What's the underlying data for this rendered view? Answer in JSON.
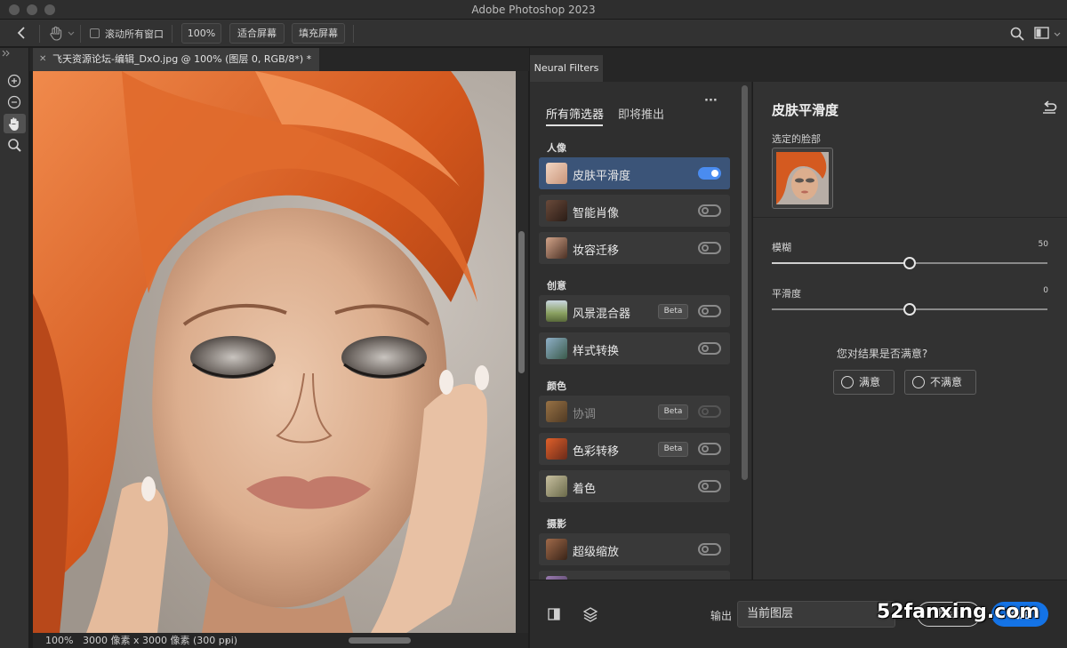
{
  "window": {
    "title": "Adobe Photoshop 2023"
  },
  "options_bar": {
    "scroll_all_label": "滚动所有窗口",
    "zoom_100": "100%",
    "fit_screen": "适合屏幕",
    "fill_screen": "填充屏幕"
  },
  "document": {
    "tab_title": "飞天资源论坛-编辑_DxO.jpg @ 100% (图层 0, RGB/8*) *",
    "zoom": "100%",
    "dimensions": "3000 像素 x 3000 像素 (300 ppi)",
    "dimensions_arrow": "›"
  },
  "panel": {
    "tab_label": "Neural Filters",
    "category_tabs": {
      "all": "所有筛选器",
      "upcoming": "即将推出",
      "more": "···"
    },
    "sections": [
      "人像",
      "创意",
      "颜色",
      "摄影"
    ],
    "beta_label": "Beta",
    "filters": [
      {
        "name": "皮肤平滑度",
        "enabled": true,
        "selected": true,
        "beta": false
      },
      {
        "name": "智能肖像",
        "enabled": false,
        "beta": false
      },
      {
        "name": "妆容迁移",
        "enabled": false,
        "beta": false
      },
      {
        "name": "风景混合器",
        "enabled": false,
        "beta": true
      },
      {
        "name": "样式转换",
        "enabled": false,
        "beta": false
      },
      {
        "name": "协调",
        "enabled": false,
        "beta": true,
        "dimmed": true
      },
      {
        "name": "色彩转移",
        "enabled": false,
        "beta": true
      },
      {
        "name": "着色",
        "enabled": false,
        "beta": false
      },
      {
        "name": "超级缩放",
        "enabled": false,
        "beta": false
      }
    ],
    "detail": {
      "title": "皮肤平滑度",
      "selected_face_label": "选定的脸部",
      "blur": {
        "label": "模糊",
        "value": 50
      },
      "smoothness": {
        "label": "平滑度",
        "value": 0
      },
      "feedback_question": "您对结果是否满意?",
      "satisfied_label": "满意",
      "unsatisfied_label": "不满意"
    },
    "footer": {
      "output_label": "输出",
      "output_value": "当前图层",
      "cancel_label": "取消",
      "ok_label": "确定"
    }
  },
  "watermark": "52fanxing.com"
}
